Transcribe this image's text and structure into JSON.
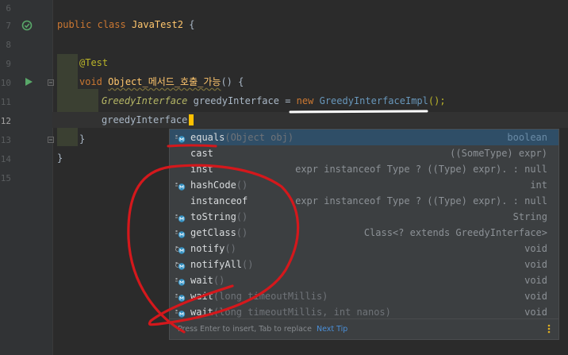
{
  "editor": {
    "line_numbers": [
      "6",
      "7",
      "8",
      "9",
      "10",
      "11",
      "12",
      "13",
      "14",
      "15"
    ],
    "line_7": {
      "kw1": "public",
      "kw2": "class",
      "classname": "JavaTest2",
      "brace": " {"
    },
    "line_9": {
      "annotation": "@Test"
    },
    "line_10": {
      "kw": "void",
      "method": "Object_메서드_호출_가능",
      "rest": "() {"
    },
    "line_11": {
      "type": "GreedyInterface",
      "var": "greedyInterface",
      "eq": " = ",
      "kw_new": "new",
      "impl": "GreedyInterfaceImpl",
      "tail": "();"
    },
    "line_12": {
      "text": "greedyInterface."
    },
    "line_13": {
      "text": "}"
    },
    "line_14": {
      "text": "}"
    }
  },
  "autocomplete": {
    "items": [
      {
        "name": "equals",
        "params": "(Object obj)",
        "type": "boolean",
        "icon": "method-icon",
        "selected": true
      },
      {
        "name": "cast",
        "params": "",
        "type": "((SomeType) expr)",
        "icon": "",
        "selected": false
      },
      {
        "name": "inst",
        "params": "",
        "type": "expr instanceof Type ? ((Type) expr). : null",
        "icon": "",
        "selected": false
      },
      {
        "name": "hashCode",
        "params": "()",
        "type": "int",
        "icon": "method-icon",
        "selected": false
      },
      {
        "name": "instanceof",
        "params": "",
        "type": "expr instanceof Type ? ((Type) expr). : null",
        "icon": "",
        "selected": false
      },
      {
        "name": "toString",
        "params": "()",
        "type": "String",
        "icon": "method-icon",
        "selected": false
      },
      {
        "name": "getClass",
        "params": "()",
        "type": "Class<? extends GreedyInterface>",
        "icon": "method-icon",
        "selected": false
      },
      {
        "name": "notify",
        "params": "()",
        "type": "void",
        "icon": "final-method-icon",
        "selected": false
      },
      {
        "name": "notifyAll",
        "params": "()",
        "type": "void",
        "icon": "final-method-icon",
        "selected": false
      },
      {
        "name": "wait",
        "params": "()",
        "type": "void",
        "icon": "method-icon",
        "selected": false
      },
      {
        "name": "wait",
        "params": "(long timeoutMillis)",
        "type": "void",
        "icon": "method-icon",
        "selected": false
      },
      {
        "name": "wait",
        "params": "(long timeoutMillis, int nanos)",
        "type": "void",
        "icon": "method-icon",
        "selected": false
      }
    ],
    "footer": {
      "hint": "Press Enter to insert, Tab to replace",
      "tip": "Next Tip"
    }
  },
  "colors": {
    "background": "#2b2b2b",
    "selection": "#2f4e67",
    "annotation_red": "#d4181c",
    "underline_white": "#ffffff"
  }
}
